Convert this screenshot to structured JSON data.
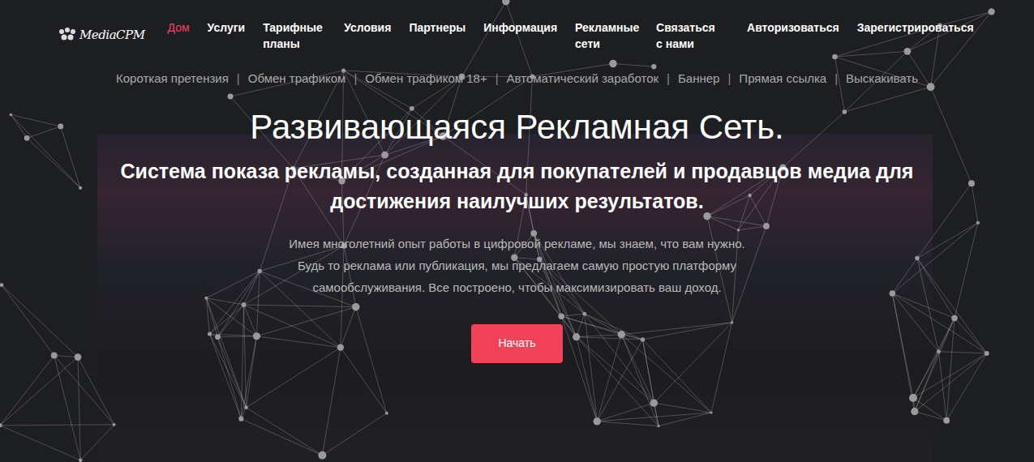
{
  "logo": {
    "text": "MediaCPM"
  },
  "nav": [
    {
      "label": "Дом",
      "selected": true
    },
    {
      "label": "Услуги",
      "selected": false
    },
    {
      "label": "Тарифные планы",
      "selected": false
    },
    {
      "label": "Условия",
      "selected": false
    },
    {
      "label": "Партнеры",
      "selected": false
    },
    {
      "label": "Информация",
      "selected": false
    },
    {
      "label": "Рекламные сети",
      "selected": false
    },
    {
      "label": "Связаться с нами",
      "selected": false
    },
    {
      "label": "Авторизоваться",
      "selected": false
    },
    {
      "label": "Зарегистрироваться",
      "selected": false
    }
  ],
  "subnav": {
    "separator": "|",
    "items": [
      "Короткая претензия",
      "Обмен трафиком",
      "Обмен трафиком 18+",
      "Автоматический заработок",
      "Баннер",
      "Прямая ссылка",
      "Выскакивать"
    ]
  },
  "hero": {
    "title": "Развивающаяся Рекламная Сеть.",
    "subtitle": "Система показа рекламы, созданная для покупателей и продавцов медиа для достижения наилучших результатов.",
    "text": "Имея многолетний опыт работы в цифровой рекламе, мы знаем, что вам нужно. Будь то реклама или публикация, мы предлагаем самую простую платформу самообслуживания. Все построено, чтобы максимизировать ваш доход.",
    "button": "Начать"
  }
}
